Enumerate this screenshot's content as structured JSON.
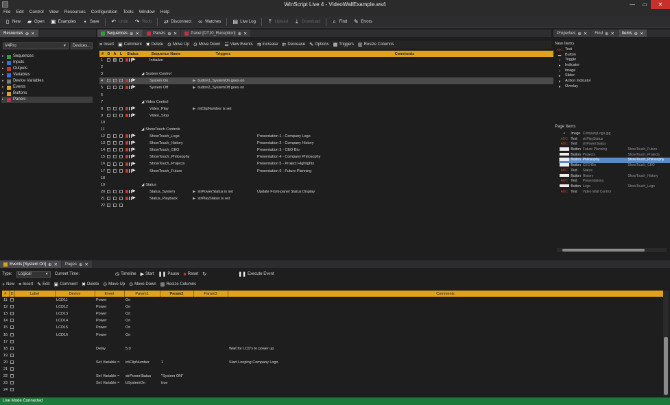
{
  "window": {
    "title": "WinScript Live 4 - VideoWallExample.ws4",
    "minimize": "—",
    "maximize": "▭",
    "close": "✕"
  },
  "menu": [
    "File",
    "Edit",
    "Control",
    "View",
    "Resources",
    "Configuration",
    "Tools",
    "Window",
    "Help"
  ],
  "toolbar": {
    "new": "New",
    "open": "Open",
    "examples": "Examples",
    "save": "Save",
    "undo": "Undo",
    "redo": "Redo",
    "disconnect": "Disconnect",
    "watches": "Watches",
    "live_log": "Live Log",
    "upload": "Upload",
    "download": "Download",
    "find": "Find",
    "errors": "Errors"
  },
  "resources": {
    "tab": "Resources",
    "device_select": "V4Pro",
    "devices_button": "Devices...",
    "tree": [
      {
        "label": "Sequences",
        "color": "#2e9e3a"
      },
      {
        "label": "Inputs",
        "color": "#3a6fd8"
      },
      {
        "label": "Outputs",
        "color": "#c0392b"
      },
      {
        "label": "Variables",
        "color": "#3a6fd8"
      },
      {
        "label": "Device Variables",
        "color": "#7a7a7a"
      },
      {
        "label": "Events",
        "color": "#e0a21a"
      },
      {
        "label": "Buttons",
        "color": "#e0a21a"
      },
      {
        "label": "Panels",
        "color": "#c0304a"
      }
    ]
  },
  "doc_tabs": [
    {
      "label": "Sequences",
      "color": "#2e9e3a",
      "active": true
    },
    {
      "label": "Panels",
      "color": "#c0304a",
      "active": false
    },
    {
      "label": "Panel [DT10_Reception]",
      "color": "#c0304a",
      "active": false
    }
  ],
  "seq_actions": [
    "Insert",
    "Comment",
    "Delete",
    "Move Up",
    "Move Down",
    "View Events",
    "Increase",
    "Decrease",
    "Options",
    "Triggers",
    "Resize Columns"
  ],
  "seq_headers": [
    "#",
    "D",
    "A",
    "L",
    "Status",
    "Sequence Name",
    "Triggers",
    "Comments"
  ],
  "sequences": [
    {
      "n": "1",
      "cbs": true,
      "x": true,
      "status": true,
      "name": "Initialize",
      "trigger": "",
      "comment": "",
      "grp": false
    },
    {
      "n": "2",
      "cbs": false,
      "status": false,
      "name": "",
      "trigger": "",
      "comment": "",
      "grp": false
    },
    {
      "n": "3",
      "cbs": false,
      "status": false,
      "name": "System Control",
      "trigger": "",
      "comment": "",
      "grp": true
    },
    {
      "n": "4",
      "cbs": true,
      "status": true,
      "name": "System On",
      "trigger": "button1_SystemOn goes on",
      "comment": "",
      "grp": false,
      "sel": true
    },
    {
      "n": "5",
      "cbs": true,
      "status": true,
      "name": "System Off",
      "trigger": "button2_SystemOff goes on",
      "comment": "",
      "grp": false
    },
    {
      "n": "6",
      "cbs": false,
      "status": false,
      "name": "",
      "trigger": "",
      "comment": "",
      "grp": false
    },
    {
      "n": "7",
      "cbs": false,
      "status": false,
      "name": "Video Control",
      "trigger": "",
      "comment": "",
      "grp": true
    },
    {
      "n": "8",
      "cbs": true,
      "status": true,
      "name": "Video_Play",
      "trigger": "intClipNumber is set",
      "comment": "",
      "grp": false
    },
    {
      "n": "9",
      "cbs": true,
      "status": true,
      "name": "Video_Stop",
      "trigger": "",
      "comment": "",
      "grp": false
    },
    {
      "n": "10",
      "cbs": false,
      "status": false,
      "name": "",
      "trigger": "",
      "comment": "",
      "grp": false
    },
    {
      "n": "11",
      "cbs": false,
      "status": false,
      "name": "ShowTouch Controls",
      "trigger": "",
      "comment": "",
      "grp": true
    },
    {
      "n": "12",
      "cbs": true,
      "status": true,
      "name": "ShowTouch_Logo",
      "trigger": "",
      "comment": "Presentation 1 - Company Logo",
      "grp": false
    },
    {
      "n": "13",
      "cbs": true,
      "status": true,
      "name": "ShowTouch_History",
      "trigger": "",
      "comment": "Presentation 2 - Company History",
      "grp": false
    },
    {
      "n": "14",
      "cbs": true,
      "status": true,
      "name": "ShowTouch_CEO",
      "trigger": "",
      "comment": "Presentation 3 - CEO Bio",
      "grp": false
    },
    {
      "n": "15",
      "cbs": true,
      "status": true,
      "name": "ShowTouch_Philosophy",
      "trigger": "",
      "comment": "Presentation 4 - Company Philosophy",
      "grp": false
    },
    {
      "n": "16",
      "cbs": true,
      "status": true,
      "name": "ShowTouch_Projects",
      "trigger": "",
      "comment": "Presentation 5 - Project Highlights",
      "grp": false
    },
    {
      "n": "17",
      "cbs": true,
      "status": true,
      "name": "ShowTouch_Future",
      "trigger": "",
      "comment": "Presentation 6 - Future Planning",
      "grp": false
    },
    {
      "n": "18",
      "cbs": false,
      "status": false,
      "name": "",
      "trigger": "",
      "comment": "",
      "grp": false
    },
    {
      "n": "19",
      "cbs": false,
      "status": false,
      "name": "Status",
      "trigger": "",
      "comment": "",
      "grp": true
    },
    {
      "n": "20",
      "cbs": true,
      "status": true,
      "name": "Status_System",
      "trigger": "strPowerStatus is set",
      "comment": "Update Front-panel Status Display",
      "grp": false
    },
    {
      "n": "21",
      "cbs": true,
      "status": true,
      "name": "Status_Playback",
      "trigger": "strPlayStatus is set",
      "comment": "",
      "grp": false
    },
    {
      "n": "22",
      "cbs": true,
      "status": false,
      "name": "",
      "trigger": "",
      "comment": "",
      "grp": false
    }
  ],
  "right_tabs": [
    {
      "label": "Properties",
      "active": false
    },
    {
      "label": "Find",
      "active": false
    },
    {
      "label": "Items",
      "active": true
    }
  ],
  "new_items": {
    "title": "New Items",
    "list": [
      {
        "icon": "ABC",
        "label": "Text"
      },
      {
        "icon": "▬",
        "label": "Button"
      },
      {
        "icon": "▪",
        "label": "Toggle"
      },
      {
        "icon": "●",
        "label": "Indicator"
      },
      {
        "icon": "▪",
        "label": "Image"
      },
      {
        "icon": "▸",
        "label": "Slider"
      },
      {
        "icon": "●",
        "label": "Action Indicator"
      },
      {
        "icon": "●",
        "label": "Overlay"
      }
    ]
  },
  "page_items": {
    "title": "Page Items",
    "list": [
      {
        "icon": "img",
        "type": "Image",
        "name": "CompanyLogo.jpg",
        "val": "",
        "sel": false
      },
      {
        "icon": "ABC",
        "type": "Text",
        "name": "strPlayStatus",
        "val": "",
        "sel": false
      },
      {
        "icon": "ABC",
        "type": "Text",
        "name": "strPowerStatus",
        "val": "",
        "sel": false
      },
      {
        "icon": "btn",
        "type": "Button",
        "name": "Future Planning",
        "val": "ShowTouch_Future",
        "sel": false
      },
      {
        "icon": "btn",
        "type": "Button",
        "name": "Projects",
        "val": "ShowTouch_Projects",
        "sel": false
      },
      {
        "icon": "btn",
        "type": "Button",
        "name": "Philosophy",
        "val": "ShowTouch_Philosophy",
        "sel": true
      },
      {
        "icon": "btn",
        "type": "Button",
        "name": "CEO Bio",
        "val": "ShowTouch_CEO",
        "sel": false
      },
      {
        "icon": "ABC",
        "type": "Text",
        "name": "Status",
        "val": "",
        "sel": false
      },
      {
        "icon": "btn",
        "type": "Button",
        "name": "History",
        "val": "ShowTouch_History",
        "sel": false
      },
      {
        "icon": "ABC",
        "type": "Text",
        "name": "Presentations",
        "val": "",
        "sel": false
      },
      {
        "icon": "btn",
        "type": "Button",
        "name": "Logo",
        "val": "ShowTouch_Logo",
        "sel": false
      },
      {
        "icon": "ABC",
        "type": "Text",
        "name": "Video Wall Control",
        "val": "",
        "sel": false
      }
    ]
  },
  "bottom_tabs": [
    {
      "label": "Events [System On]",
      "color": "#e0a21a",
      "active": true
    },
    {
      "label": "Pages",
      "color": "",
      "active": false
    }
  ],
  "event_toolbar": {
    "type_label": "Type:",
    "type_value": "Logical",
    "current_time_label": "Current Time:",
    "timeline": "Timeline",
    "start": "Start",
    "pause": "Pause",
    "reset": "Reset",
    "execute": "Execute Event"
  },
  "event_actions": [
    "New",
    "Insert",
    "Edit",
    "Comment",
    "Delete",
    "Move Up",
    "Move Down",
    "Resize Columns"
  ],
  "event_headers": [
    "#",
    "D",
    "Label",
    "Device",
    "Event",
    "Param1",
    "Param2",
    "Param3",
    "Comments"
  ],
  "events": [
    {
      "n": "11",
      "label": "",
      "device": "LCD11",
      "event": "Power",
      "p1": "On",
      "p2": "",
      "p3": "",
      "comment": ""
    },
    {
      "n": "12",
      "label": "",
      "device": "LCD12",
      "event": "Power",
      "p1": "On",
      "p2": "",
      "p3": "",
      "comment": ""
    },
    {
      "n": "13",
      "label": "",
      "device": "LCD13",
      "event": "Power",
      "p1": "On",
      "p2": "",
      "p3": "",
      "comment": ""
    },
    {
      "n": "14",
      "label": "",
      "device": "LCD14",
      "event": "Power",
      "p1": "On",
      "p2": "",
      "p3": "",
      "comment": ""
    },
    {
      "n": "15",
      "label": "",
      "device": "LCD15",
      "event": "Power",
      "p1": "On",
      "p2": "",
      "p3": "",
      "comment": ""
    },
    {
      "n": "16",
      "label": "",
      "device": "LCD16",
      "event": "Power",
      "p1": "On",
      "p2": "",
      "p3": "",
      "comment": ""
    },
    {
      "n": "17",
      "label": "",
      "device": "",
      "event": "",
      "p1": "",
      "p2": "",
      "p3": "",
      "comment": ""
    },
    {
      "n": "18",
      "label": "",
      "device": "",
      "event": "Delay",
      "p1": "5.0",
      "p2": "",
      "p3": "",
      "comment": "Wait for LCD's to power up"
    },
    {
      "n": "19",
      "label": "",
      "device": "",
      "event": "",
      "p1": "",
      "p2": "",
      "p3": "",
      "comment": ""
    },
    {
      "n": "20",
      "label": "",
      "device": "",
      "event": "Set Variable =",
      "p1": "intClipNumber",
      "p2": "1",
      "p3": "",
      "comment": "Start Looping Company Logo"
    },
    {
      "n": "21",
      "label": "",
      "device": "",
      "event": "",
      "p1": "",
      "p2": "",
      "p3": "",
      "comment": ""
    },
    {
      "n": "22",
      "label": "",
      "device": "",
      "event": "Set Variable =",
      "p1": "strPowerStatus",
      "p2": "\"System ON\"",
      "p3": "",
      "comment": ""
    },
    {
      "n": "23",
      "label": "",
      "device": "",
      "event": "Set Variable =",
      "p1": "bSystemOn",
      "p2": "true",
      "p3": "",
      "comment": ""
    },
    {
      "n": "24",
      "label": "",
      "device": "",
      "event": "",
      "p1": "",
      "p2": "",
      "p3": "",
      "comment": ""
    }
  ],
  "status": "Live Mode Connected"
}
